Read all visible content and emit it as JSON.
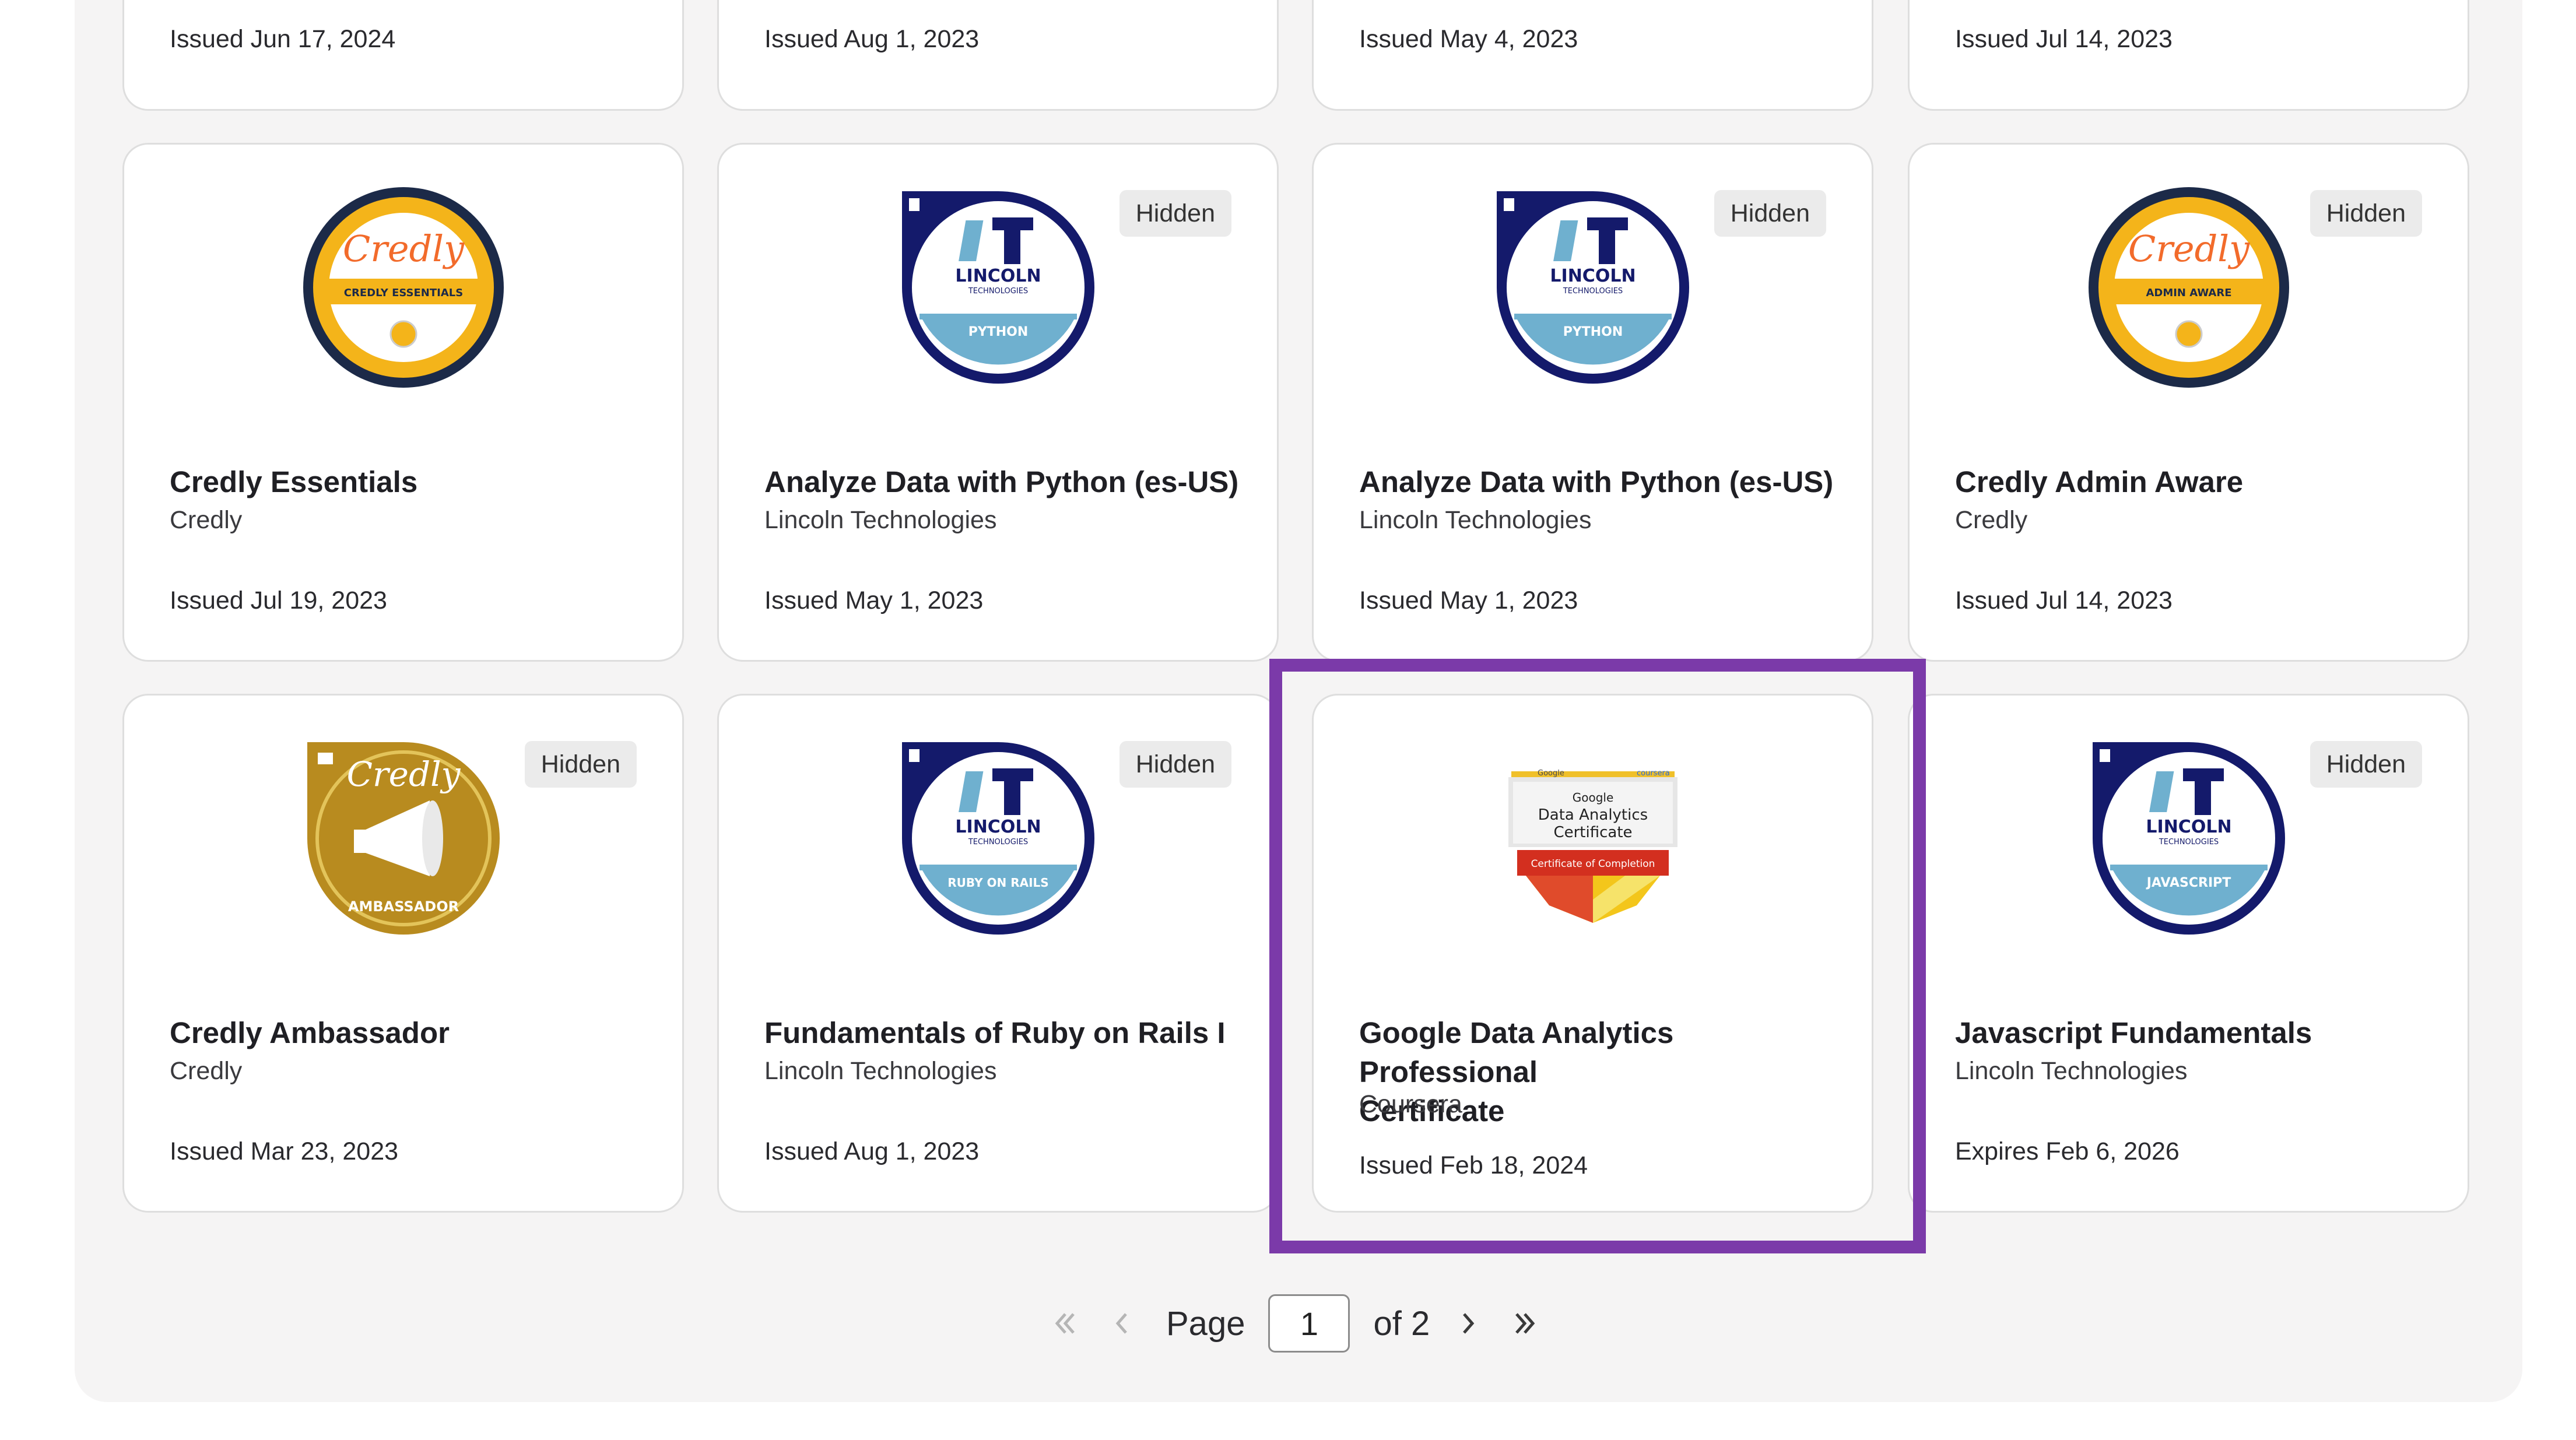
{
  "top_row": [
    {
      "issued": "Issued Jun 17, 2024"
    },
    {
      "issued": "Issued Aug 1, 2023"
    },
    {
      "issued": "Issued May 4, 2023"
    },
    {
      "issued": "Issued Jul 14, 2023"
    }
  ],
  "row2": [
    {
      "badge": "Credly",
      "badge_banner": "CREDLY ESSENTIALS",
      "title": "Credly Essentials",
      "issuer": "Credly",
      "issued": "Issued Jul 19, 2023"
    },
    {
      "badge": "LINCOLN",
      "badge_sub": "TECHNOLOGIES",
      "badge_banner": "PYTHON",
      "hidden": "Hidden",
      "title": "Analyze Data with Python (es-US)",
      "issuer": "Lincoln Technologies",
      "issued": "Issued May 1, 2023"
    },
    {
      "badge": "LINCOLN",
      "badge_sub": "TECHNOLOGIES",
      "badge_banner": "PYTHON",
      "hidden": "Hidden",
      "title": "Analyze Data with Python (es-US)",
      "issuer": "Lincoln Technologies",
      "issued": "Issued May 1, 2023"
    },
    {
      "badge": "Credly",
      "badge_banner": "ADMIN AWARE",
      "hidden": "Hidden",
      "title": "Credly Admin Aware",
      "issuer": "Credly",
      "issued": "Issued Jul 14, 2023"
    }
  ],
  "row3": [
    {
      "badge": "Credly",
      "badge_banner": "AMBASSADOR",
      "hidden": "Hidden",
      "title": "Credly Ambassador",
      "issuer": "Credly",
      "issued": "Issued Mar 23, 2023"
    },
    {
      "badge": "LINCOLN",
      "badge_sub": "TECHNOLOGIES",
      "badge_banner": "RUBY ON RAILS",
      "hidden": "Hidden",
      "title": "Fundamentals of Ruby on Rails I",
      "issuer": "Lincoln Technologies",
      "issued": "Issued Aug 1, 2023"
    },
    {
      "badge_top_left": "Google",
      "badge_top_right": "coursera",
      "badge_line1": "Google",
      "badge_line2": "Data Analytics",
      "badge_line3": "Certificate",
      "badge_banner": "Certificate of Completion",
      "title_line1": "Google Data Analytics Professional",
      "title_line2": "Certificate",
      "issuer": "Coursera",
      "issued": "Issued Feb 18, 2024"
    },
    {
      "badge": "LINCOLN",
      "badge_sub": "TECHNOLOGIES",
      "badge_banner": "JAVASCRIPT",
      "hidden": "Hidden",
      "title": "Javascript Fundamentals",
      "issuer": "Lincoln Technologies",
      "issued": "Expires Feb 6, 2026"
    }
  ],
  "pagination": {
    "page_label": "Page",
    "current_page": "1",
    "of_label": "of 2"
  },
  "colors": {
    "highlight": "#7b3aa9",
    "credly_gold": "#f4b41a",
    "credly_navy": "#1c2a48",
    "lincoln_navy": "#141a6b",
    "lincoln_blue": "#6fb0cf",
    "ambassador_gold": "#b88b1f"
  }
}
